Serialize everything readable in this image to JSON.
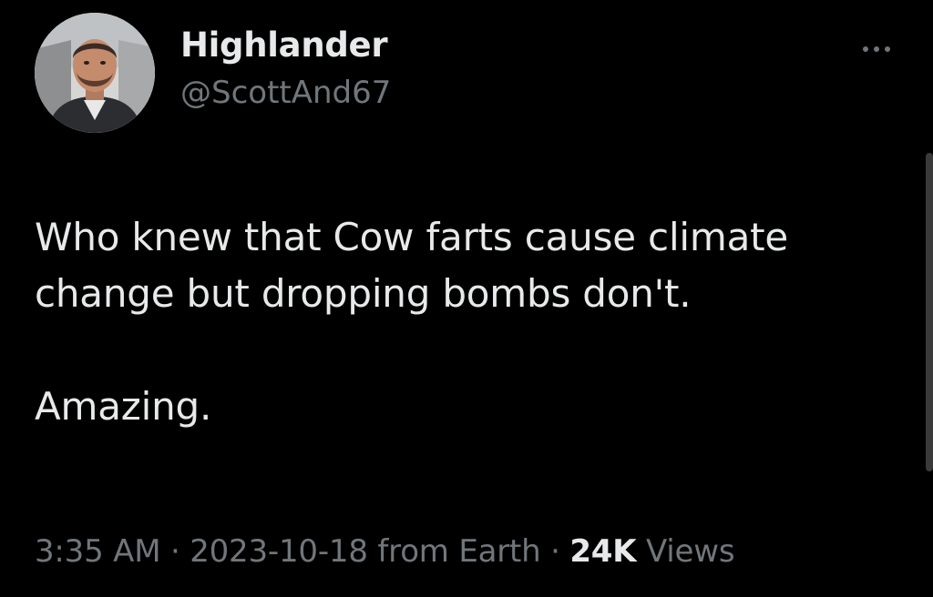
{
  "author": {
    "display_name": "Highlander",
    "handle": "@ScottAnd67",
    "avatar_icon": "user-avatar-photo"
  },
  "more_icon": "more-horizontal-icon",
  "tweet": {
    "line1": "Who knew that Cow farts cause climate",
    "line2": "change but dropping bombs don't.",
    "line3": "Amazing."
  },
  "meta": {
    "time": "3:35 AM",
    "separator": "·",
    "date": "2023-10-18",
    "source": "from Earth",
    "views_count": "24K",
    "views_label": "Views"
  },
  "colors": {
    "background": "#000000",
    "primary_text": "#e7e9ea",
    "secondary_text": "#71767b"
  }
}
